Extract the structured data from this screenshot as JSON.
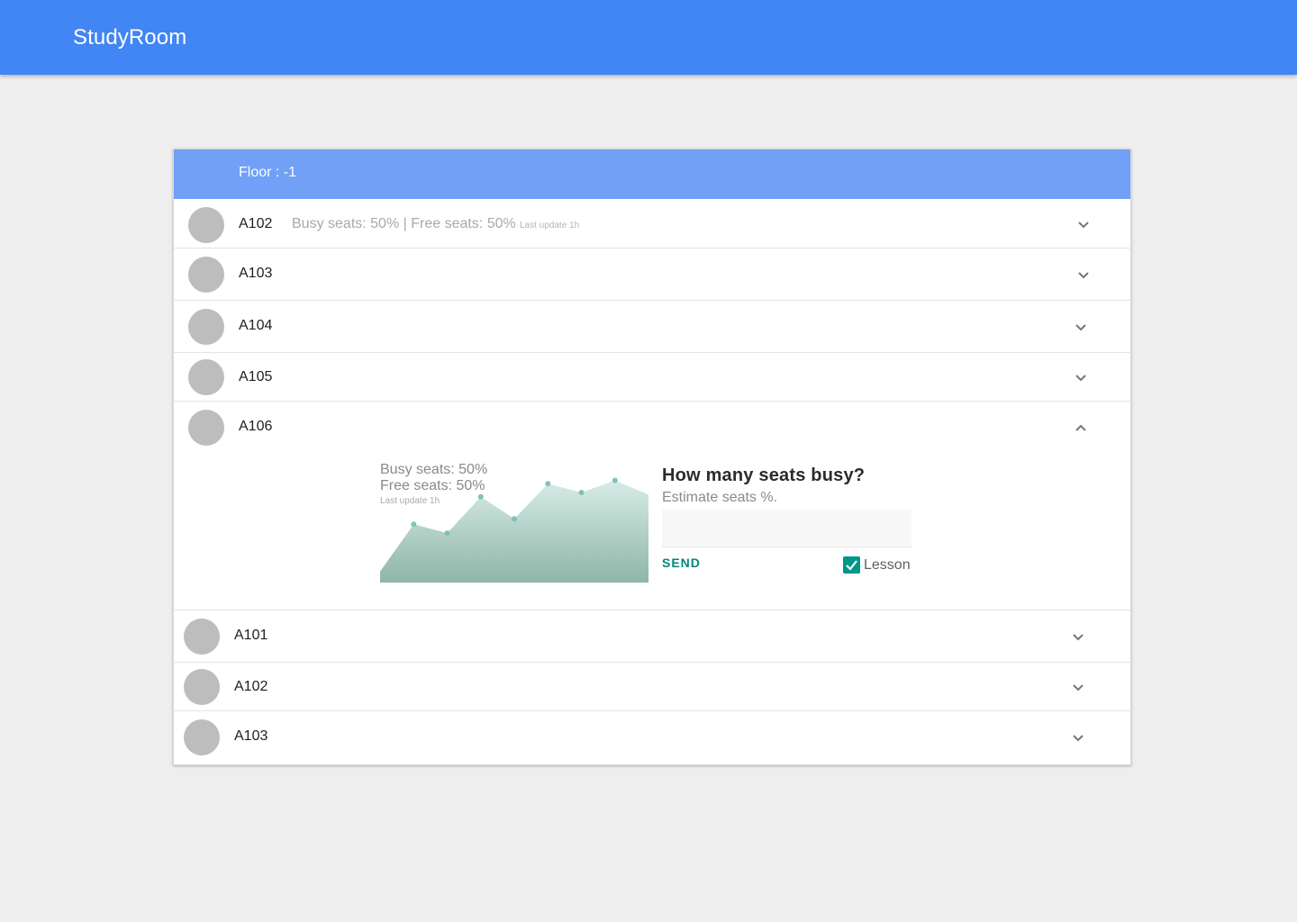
{
  "app": {
    "title": "StudyRoom"
  },
  "floor": {
    "label": "Floor :  -1"
  },
  "rooms_top": [
    {
      "name": "A102",
      "summary": "Busy seats: 50% | Free seats: 50%",
      "update": "Last update 1h",
      "expanded": false
    },
    {
      "name": "A103",
      "expanded": false
    },
    {
      "name": "A104",
      "expanded": false
    },
    {
      "name": "A105",
      "expanded": false
    },
    {
      "name": "A106",
      "expanded": true
    }
  ],
  "expanded_room": {
    "busy_label": "Busy seats: 50%",
    "free_label": "Free seats: 50%",
    "update_label": "Last update 1h",
    "form": {
      "title": "How many seats busy?",
      "subtitle": "Estimate seats %.",
      "input_value": "",
      "send_label": "SEND",
      "checkbox_label": "Lesson",
      "checkbox_checked": true
    }
  },
  "rooms_bottom": [
    {
      "name": "A101",
      "expanded": false
    },
    {
      "name": "A102",
      "expanded": false
    },
    {
      "name": "A103",
      "expanded": false
    }
  ],
  "colors": {
    "appbar": "#4285f4",
    "floor_header": "#71a0f6",
    "accent": "#009688",
    "avatar": "#bdbdbd",
    "background": "#eeeeee"
  },
  "chart_data": {
    "type": "area",
    "values": [
      10,
      53,
      45,
      78,
      58,
      90,
      82,
      93,
      80
    ],
    "title": "",
    "xlabel": "",
    "ylabel": "",
    "ylim": [
      0,
      100
    ]
  }
}
